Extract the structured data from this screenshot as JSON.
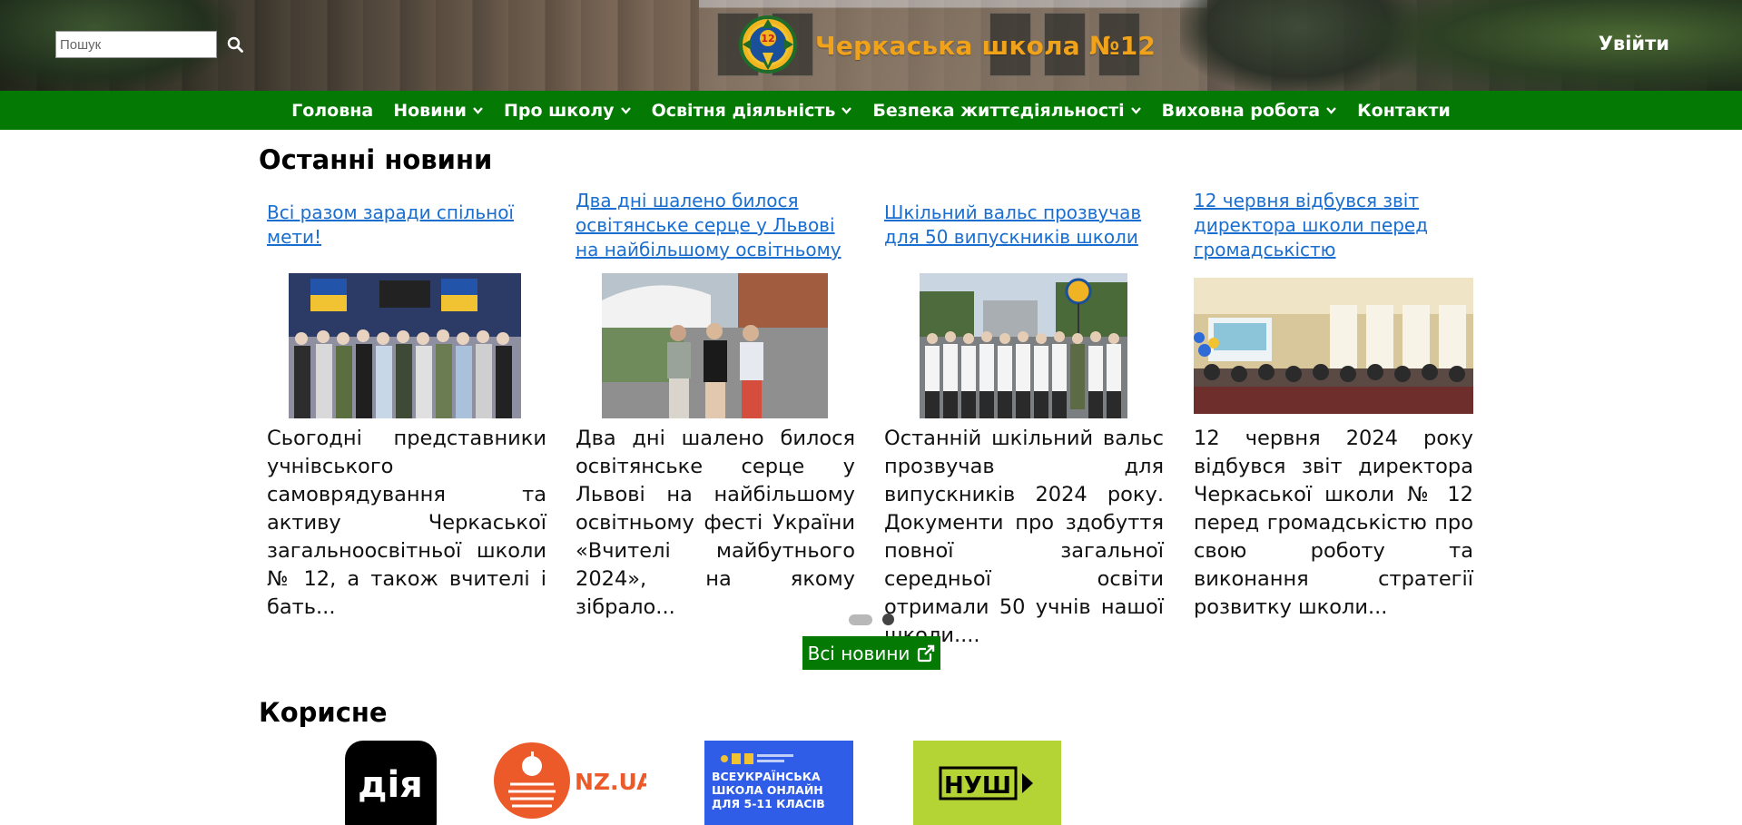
{
  "header": {
    "search_placeholder": "Пошук",
    "search_icon": "search-icon",
    "school_name": "Черкаська школа №12",
    "emblem_number": "12",
    "login_label": "Увійти"
  },
  "nav": {
    "items": [
      {
        "label": "Головна",
        "has_dropdown": false
      },
      {
        "label": "Новини",
        "has_dropdown": true
      },
      {
        "label": "Про школу",
        "has_dropdown": true
      },
      {
        "label": "Освітня діяльність",
        "has_dropdown": true
      },
      {
        "label": "Безпека життєдіяльності",
        "has_dropdown": true
      },
      {
        "label": "Виховна робота",
        "has_dropdown": true
      },
      {
        "label": "Контакти",
        "has_dropdown": false
      }
    ]
  },
  "news": {
    "section_title": "Останні новини",
    "items": [
      {
        "title": "Всі разом заради спільної мети!",
        "excerpt": "Сьогодні представники учнівського самоврядування та активу Черкаської загальноосвітньої школи № 12, а також вчителі і бать..."
      },
      {
        "title": "Два дні шалено билося освітянське серце у Львові на найбільшому освітньому фес...",
        "excerpt": "Два дні шалено билося освітянське серце у Львові на найбільшому освітньому фесті України «Вчителі майбутнього 2024», на якому зібрало..."
      },
      {
        "title": "Шкільний вальс прозвучав для 50 випускників школи",
        "excerpt": "Останній шкільний вальс прозвучав для випускників 2024 року. Документи про здобуття повної загальної середньої освіти отримали 50 учнів нашої школи...."
      },
      {
        "title": "12 червня відбувся звіт директора школи перед громадськістю",
        "excerpt": "12 червня 2024 року відбувся звіт директора Черкаської школи № 12 перед громадськістю про свою роботу та виконання стратегії розвитку школи..."
      }
    ],
    "carousel": {
      "pages": 2,
      "active_page": 1
    },
    "all_news_label": "Всі новини"
  },
  "useful": {
    "section_title": "Корисне",
    "tiles": [
      {
        "name": "diia",
        "text": "дія"
      },
      {
        "name": "nz-ua",
        "text": "NZ.UA"
      },
      {
        "name": "all-ukrainian-online-school",
        "text": "ВСЕУКРАЇНСЬКА ШКОЛА ОНЛАЙН ДЛЯ 5-11 КЛАСІВ"
      },
      {
        "name": "nush",
        "text": "НУШ"
      }
    ]
  },
  "colors": {
    "nav_green": "#047a04",
    "link_blue": "#1a6ed0",
    "title_orange": "#f0a21a",
    "nush_lime": "#b4d334",
    "school_online_blue": "#2f5de8",
    "nz_orange": "#ec5a2a"
  }
}
